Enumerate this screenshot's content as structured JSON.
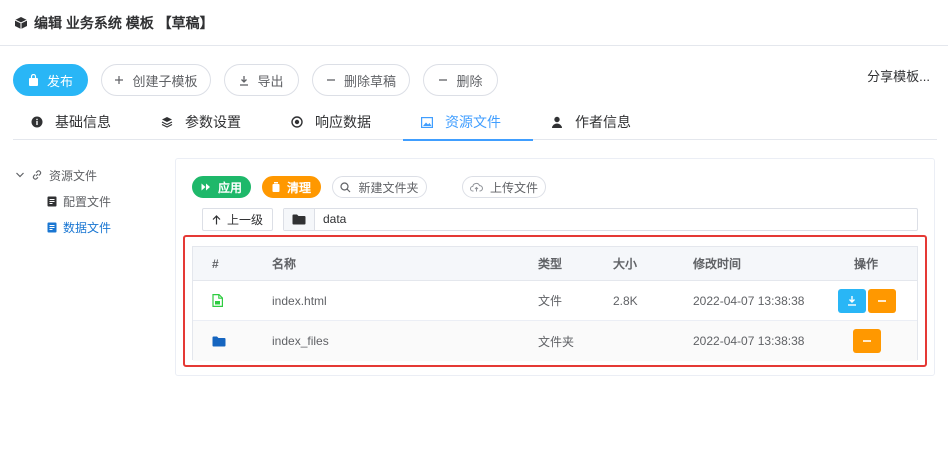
{
  "header": {
    "title": "编辑 业务系统 模板 【草稿】",
    "icon": "cube-icon"
  },
  "toolbar": {
    "publish": "发布",
    "create_child": "创建子模板",
    "export": "导出",
    "delete_draft": "删除草稿",
    "delete": "删除",
    "share": "分享模板..."
  },
  "tabs": [
    {
      "label": "基础信息",
      "icon": "info-icon"
    },
    {
      "label": "参数设置",
      "icon": "layers-icon"
    },
    {
      "label": "响应数据",
      "icon": "target-icon"
    },
    {
      "label": "资源文件",
      "icon": "image-icon",
      "active": true
    },
    {
      "label": "作者信息",
      "icon": "person-icon"
    }
  ],
  "tree": {
    "root": "资源文件",
    "children": [
      "配置文件",
      "数据文件"
    ],
    "selected": "数据文件"
  },
  "file_toolbar": {
    "apply": "应用",
    "clean": "清理",
    "new_folder": "新建文件夹",
    "upload": "上传文件"
  },
  "path": {
    "up": "上一级",
    "current": "data"
  },
  "table": {
    "headers": [
      "#",
      "名称",
      "类型",
      "大小",
      "修改时间",
      "操作"
    ],
    "rows": [
      {
        "name": "index.html",
        "type": "文件",
        "size": "2.8K",
        "modified": "2022-04-07 13:38:38"
      },
      {
        "name": "index_files",
        "type": "文件夹",
        "size": "",
        "modified": "2022-04-07 13:38:38"
      }
    ]
  },
  "colors": {
    "primary": "#29b6f6",
    "tab_active": "#409eff",
    "success": "#1eb86a",
    "warning": "#ff9800",
    "highlight": "#e53935",
    "folder": "#1565c0",
    "file": "#2ecc40"
  }
}
